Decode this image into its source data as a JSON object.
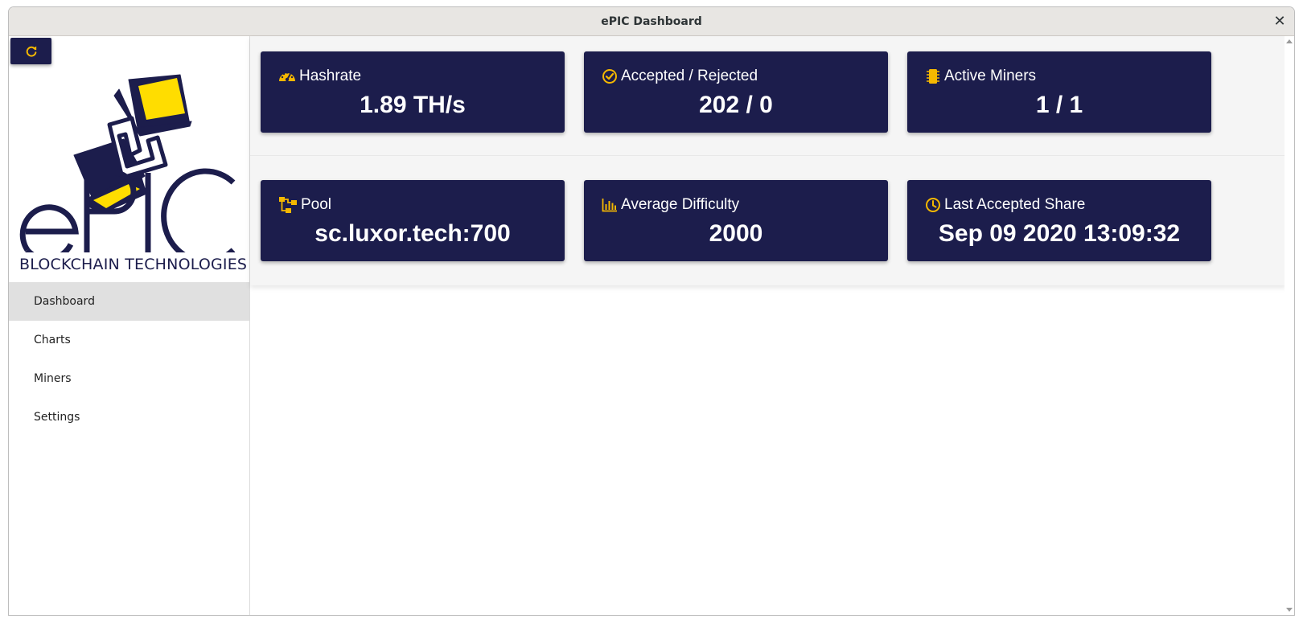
{
  "window": {
    "title": "ePIC Dashboard",
    "close_glyph": "✕"
  },
  "colors": {
    "navy": "#1c1d4c",
    "accent_yellow": "#f5b800",
    "logo_yellow": "#ffdd00"
  },
  "sidebar": {
    "refresh_icon": "refresh-icon",
    "logo": {
      "wordmark": "ePIC",
      "tagline": "BLOCKCHAIN TECHNOLOGIES"
    },
    "nav": [
      {
        "label": "Dashboard",
        "active": true
      },
      {
        "label": "Charts",
        "active": false
      },
      {
        "label": "Miners",
        "active": false
      },
      {
        "label": "Settings",
        "active": false
      }
    ]
  },
  "cards": [
    {
      "icon": "speedometer-icon",
      "label": "Hashrate",
      "value": "1.89 TH/s"
    },
    {
      "icon": "check-circle-icon",
      "label": "Accepted / Rejected",
      "value": "202 / 0"
    },
    {
      "icon": "chip-icon",
      "label": "Active Miners",
      "value": "1 / 1"
    },
    {
      "icon": "network-icon",
      "label": "Pool",
      "value": "sc.luxor.tech:700"
    },
    {
      "icon": "bar-chart-icon",
      "label": "Average Difficulty",
      "value": "2000"
    },
    {
      "icon": "clock-icon",
      "label": "Last Accepted Share",
      "value": "Sep 09 2020 13:09:32"
    }
  ]
}
